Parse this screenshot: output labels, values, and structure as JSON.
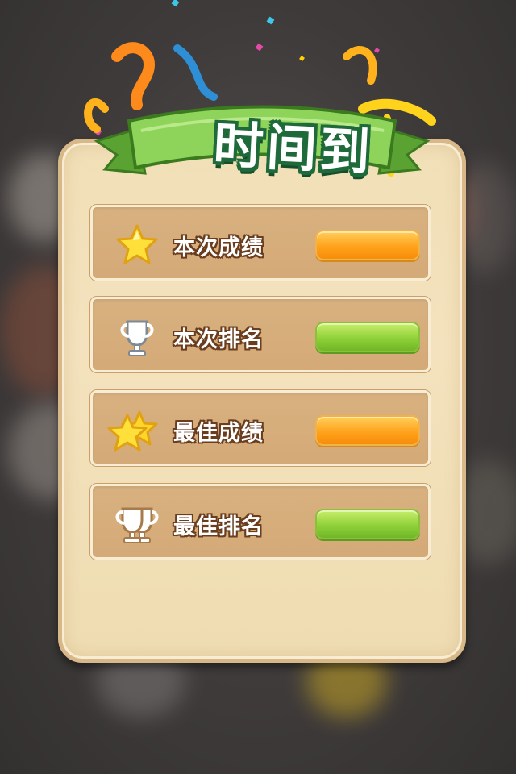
{
  "title": "时间到",
  "colors": {
    "panel": "#f2e0b9",
    "row": "#d6ae7b",
    "bar_orange": "#ffa21c",
    "bar_green": "#8fd13a",
    "ribbon": "#7cc84a",
    "title_outline": "#1f6a3a"
  },
  "rows": [
    {
      "icon": "star-icon",
      "label": "本次成绩",
      "bar_color": "orange"
    },
    {
      "icon": "trophy-icon",
      "label": "本次排名",
      "bar_color": "green"
    },
    {
      "icon": "double-star-icon",
      "label": "最佳成绩",
      "bar_color": "orange"
    },
    {
      "icon": "double-trophy-icon",
      "label": "最佳排名",
      "bar_color": "green"
    }
  ]
}
